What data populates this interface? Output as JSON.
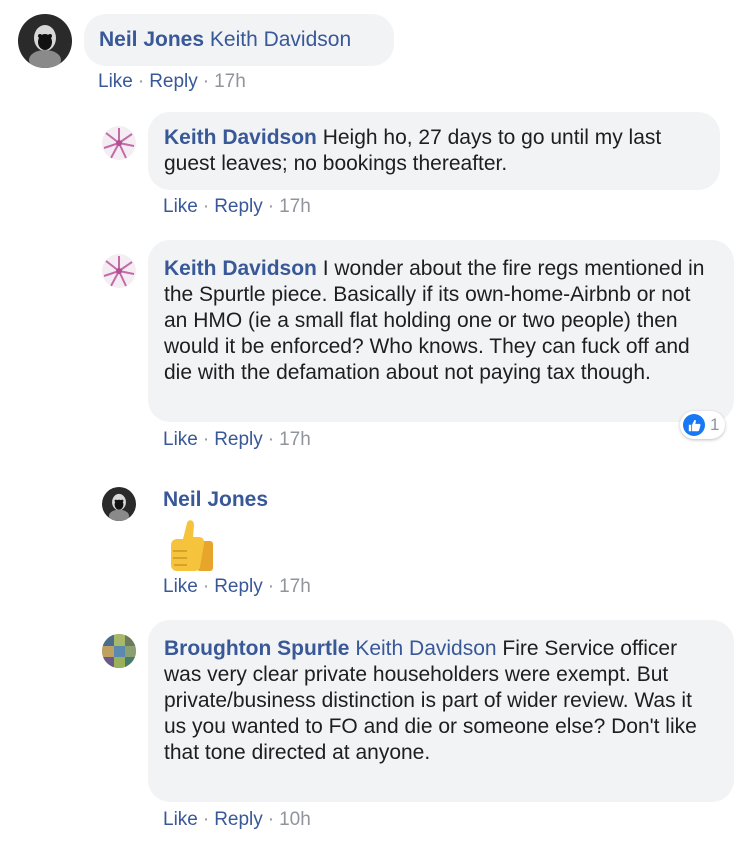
{
  "comments": [
    {
      "author": "Neil Jones",
      "tag": "Keith Davidson",
      "text": "",
      "like_label": "Like",
      "reply_label": "Reply",
      "time": "17h"
    },
    {
      "author": "Keith Davidson",
      "text": "Heigh ho, 27 days to go until my last guest leaves; no bookings thereafter.",
      "like_label": "Like",
      "reply_label": "Reply",
      "time": "17h"
    },
    {
      "author": "Keith Davidson",
      "text": "I wonder about the fire regs mentioned in the Spurtle piece. Basically if its own-home-Airbnb or not an HMO (ie a small flat holding one or two people) then would it be enforced? Who knows. They can fuck off and die with the defamation about not paying tax though.",
      "like_label": "Like",
      "reply_label": "Reply",
      "time": "17h",
      "reaction_count": "1",
      "reaction_icon": "like-reaction-icon"
    },
    {
      "author": "Neil Jones",
      "sticker": "thumbs-up-icon",
      "like_label": "Like",
      "reply_label": "Reply",
      "time": "17h"
    },
    {
      "author": "Broughton Spurtle",
      "tag": "Keith Davidson",
      "text": "Fire Service officer was very clear private householders were exempt. But private/business distinction is part of wider review. Was it us you wanted to FO and die or someone else? Don't like that tone directed at anyone.",
      "like_label": "Like",
      "reply_label": "Reply",
      "time": "10h"
    }
  ],
  "separator": "·",
  "colors": {
    "link": "#385898",
    "bubble": "#f2f3f5",
    "meta": "#90949c",
    "like_blue": "#1877f2"
  }
}
